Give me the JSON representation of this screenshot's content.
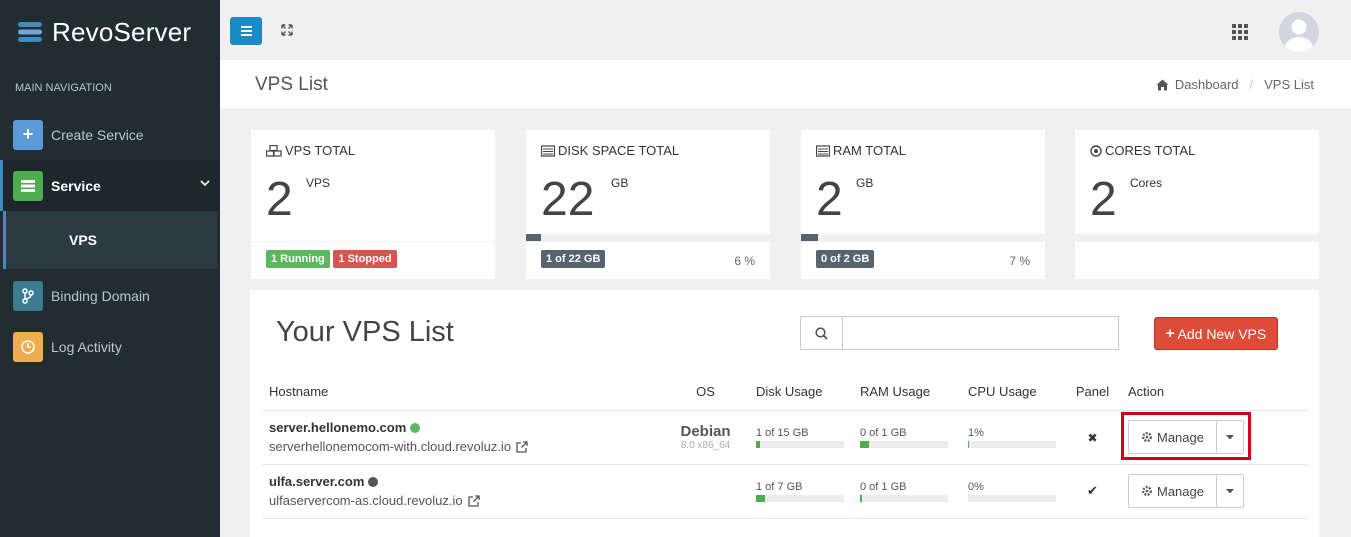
{
  "brand": {
    "name": "RevoServer"
  },
  "sidebar": {
    "header": "MAIN NAVIGATION",
    "items": [
      {
        "label": "Create Service",
        "icon": "plus-icon",
        "color": "#5a9ad5"
      },
      {
        "label": "Service",
        "icon": "server-icon",
        "color": "#4cae4c"
      },
      {
        "label": "Binding Domain",
        "icon": "branch-icon",
        "color": "#3a7d93"
      },
      {
        "label": "Log Activity",
        "icon": "clock-icon",
        "color": "#f0ad4e"
      }
    ],
    "sub_item": "VPS"
  },
  "header": {
    "page_title": "VPS List",
    "breadcrumb": {
      "home": "Dashboard",
      "current": "VPS List"
    }
  },
  "stats": {
    "vps": {
      "label": "VPS TOTAL",
      "value": "2",
      "unit": "VPS",
      "running": "1 Running",
      "stopped": "1 Stopped",
      "icon": "cubes-icon"
    },
    "disk": {
      "label": "DISK SPACE TOTAL",
      "value": "22",
      "unit": "GB",
      "badge": "1 of 22 GB",
      "percent": "6 %",
      "fill_fraction": 0.06,
      "icon": "hdd-icon"
    },
    "ram": {
      "label": "RAM TOTAL",
      "value": "2",
      "unit": "GB",
      "badge": "0 of 2 GB",
      "percent": "7 %",
      "fill_fraction": 0.07,
      "icon": "memory-icon"
    },
    "cores": {
      "label": "CORES TOTAL",
      "value": "2",
      "unit": "Cores",
      "icon": "circle-dot-icon"
    }
  },
  "vps_list": {
    "title": "Your VPS List",
    "search_placeholder": "",
    "add_button": "Add New VPS",
    "columns": [
      "Hostname",
      "OS",
      "Disk Usage",
      "RAM Usage",
      "CPU Usage",
      "Panel",
      "Action"
    ],
    "rows": [
      {
        "hostname": "server.hellonemo.com",
        "status_color": "#5cb85c",
        "link": "serverhellonemocom-with.cloud.revoluz.io",
        "os": "Debian",
        "os_version": "8.0 x86_64",
        "disk": "1 of 15 GB",
        "disk_fill": 0.05,
        "ram": "0 of 1 GB",
        "ram_fill": 0.1,
        "cpu": "1%",
        "cpu_fill": 0.01,
        "panel": "✖",
        "action": "Manage"
      },
      {
        "hostname": "ulfa.server.com",
        "status_color": "#555555",
        "link": "ulfaservercom-as.cloud.revoluz.io",
        "os": "",
        "os_version": "",
        "disk": "1 of 7 GB",
        "disk_fill": 0.1,
        "ram": "0 of 1 GB",
        "ram_fill": 0.02,
        "cpu": "0%",
        "cpu_fill": 0,
        "panel": "✔",
        "action": "Manage"
      }
    ]
  }
}
